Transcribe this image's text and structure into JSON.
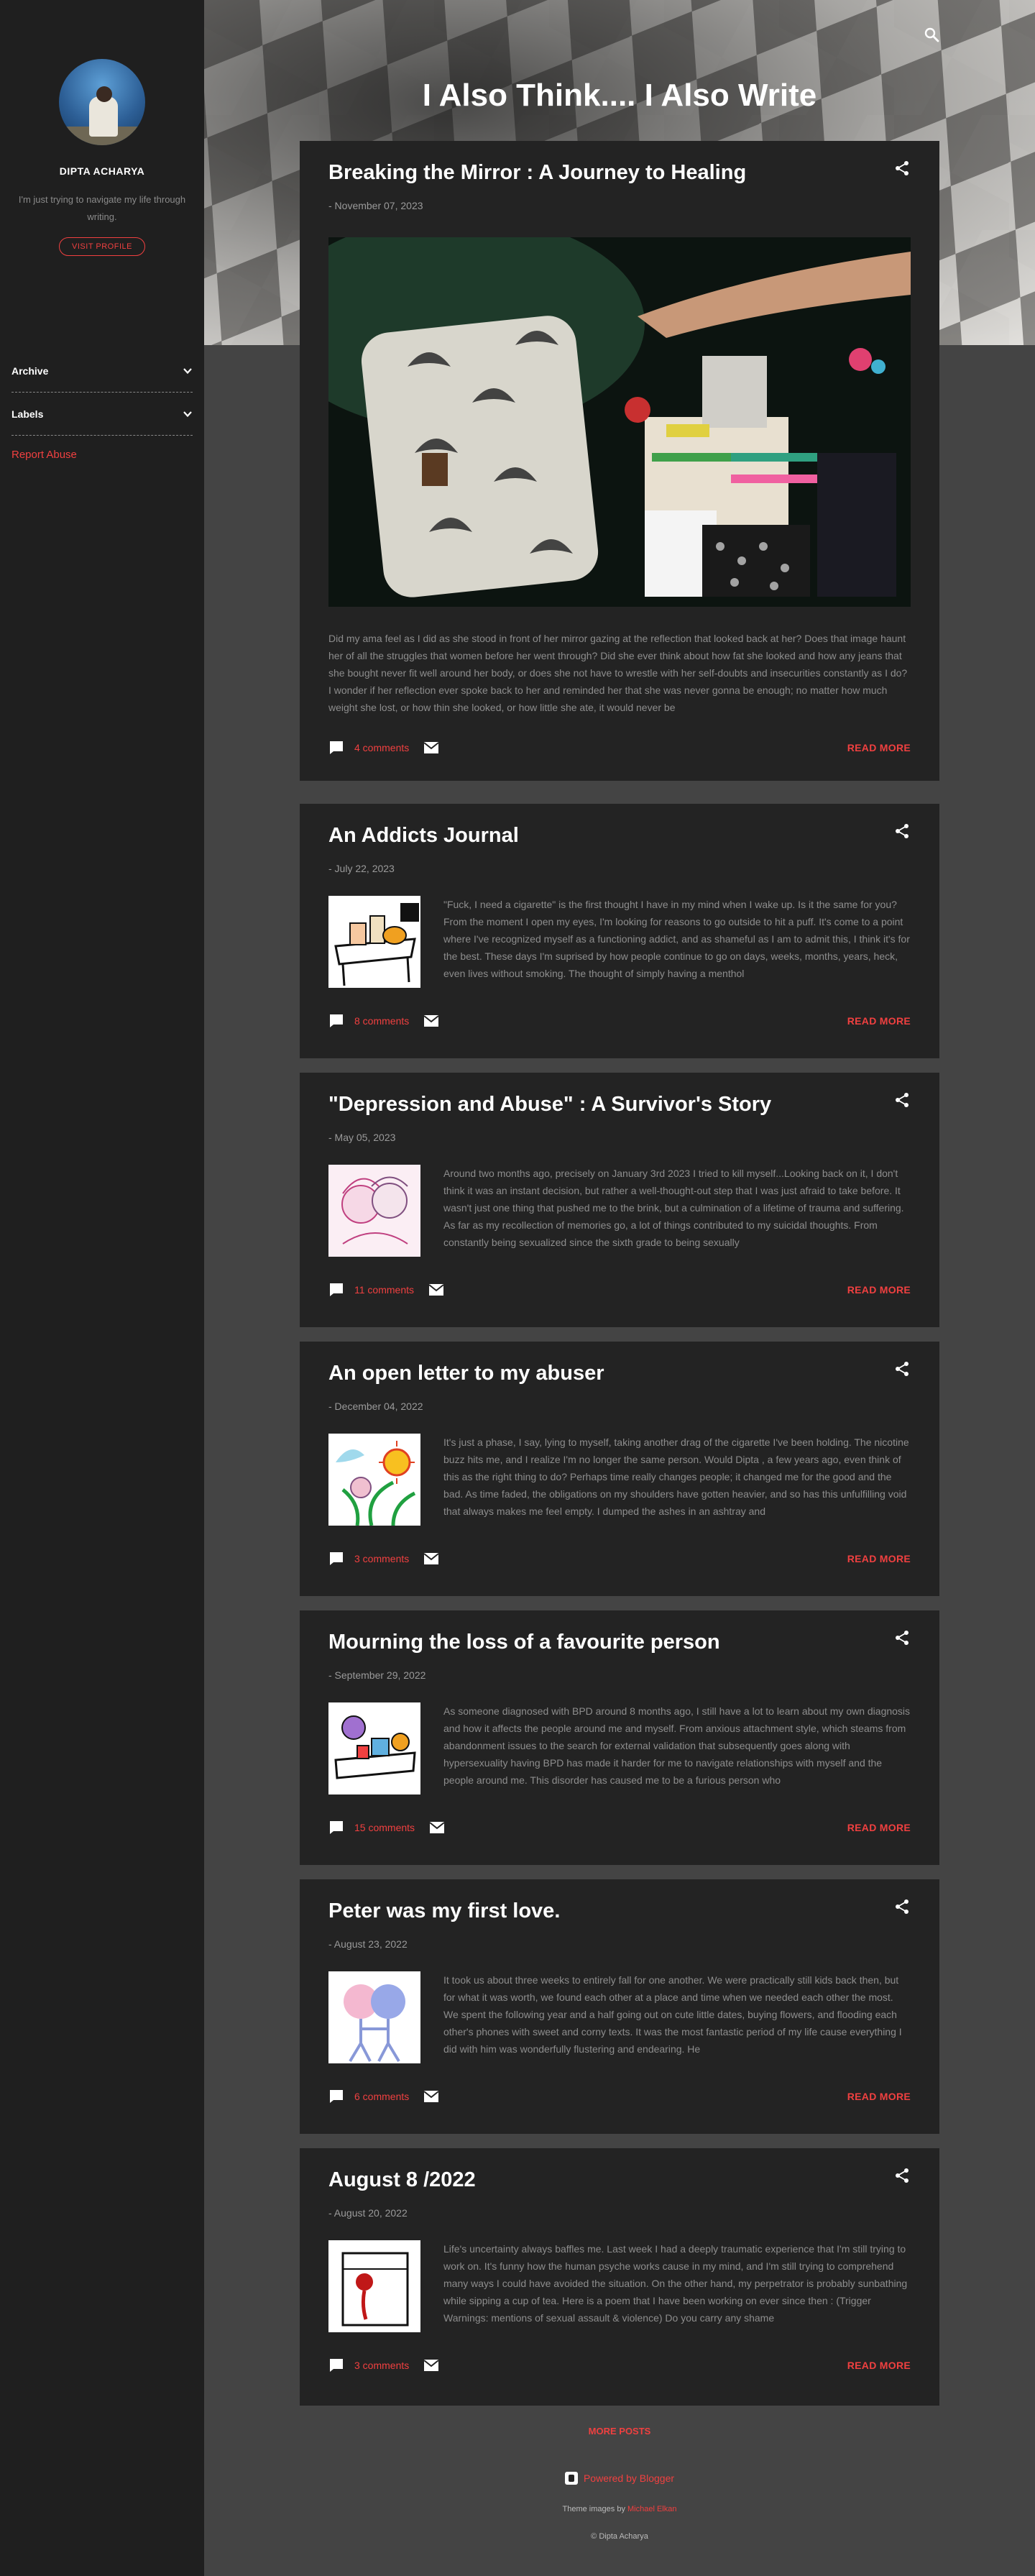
{
  "sidebar": {
    "profile_name": "DIPTA ACHARYA",
    "profile_desc": "I'm just trying to navigate my life through writing.",
    "visit_profile": "VISIT PROFILE",
    "sections": [
      {
        "label": "Archive"
      },
      {
        "label": "Labels"
      }
    ],
    "report_abuse": "Report Abuse"
  },
  "header": {
    "title": "I Also Think.... I Also Write"
  },
  "posts": [
    {
      "title": "Breaking the Mirror : A Journey to Healing",
      "date": "- November 07, 2023",
      "snippet": "Did my ama feel as I did as she stood in front of her mirror gazing at the reflection that looked back at her? Does that image haunt her of all the struggles that women before her went through? Did she ever think about how fat she looked and how any jeans that she bought never fit well around her body, or does she not have to wrestle with her self-doubts and insecurities constantly as I do? I wonder if her reflection ever spoke back to her and reminded her that she was never gonna be enough; no matter how much weight she lost, or how thin she looked, or how little she ate, it would never be",
      "comments": "4 comments",
      "read_more": "READ MORE"
    },
    {
      "title": "An Addicts Journal",
      "date": "- July 22, 2023",
      "snippet": "\"Fuck, I need a cigarette\" is the first thought I have in my mind when I wake up. Is it the same for you? From the moment I open my eyes, I'm looking for reasons to go outside to hit a puff. It's come to a point where I've recognized myself as a functioning addict, and as shameful as I am to admit this, I think it's for the best.  These days I'm suprised by how people continue to go on days, weeks, months, years, heck, even lives without smoking. The thought of simply having a menthol",
      "comments": "8 comments",
      "read_more": "READ MORE"
    },
    {
      "title": "\"Depression and Abuse\" : A Survivor's Story",
      "date": "- May 05, 2023",
      "snippet": "Around two months ago, precisely on January 3rd 2023 I tried to kill myself...Looking back on it, I don't think it was an instant decision, but rather a well-thought-out step that I was just afraid to take before. It wasn't just one thing that pushed me to the brink, but a culmination of a lifetime of trauma and suffering. As far as my recollection of memories go, a lot of things contributed to my suicidal thoughts. From constantly being sexualized since the sixth grade to being sexually",
      "comments": "11 comments",
      "read_more": "READ MORE"
    },
    {
      "title": "An open letter to my abuser",
      "date": "- December 04, 2022",
      "snippet": "It's just a phase, I say, lying to myself, taking another drag of the cigarette I've been holding. The nicotine buzz hits me, and I realize I'm no longer the same person. Would Dipta , a few years ago, even think of this as the right thing to do? Perhaps time really changes people; it changed me for the good and the bad. As time faded, the obligations on my shoulders have gotten heavier, and so has this unfulfilling void that always makes me feel empty. I dumped the ashes in an ashtray and",
      "comments": "3 comments",
      "read_more": "READ MORE"
    },
    {
      "title": "Mourning the loss of a favourite person",
      "date": "- September 29, 2022",
      "snippet": "As someone diagnosed with BPD around 8 months ago, I still have a lot to learn about my own diagnosis and how it affects the people around me and myself. From anxious attachment style, which steams from abandonment issues to the search for external validation that subsequently goes along with hypersexuality having BPD has made it harder for me to navigate relationships with myself and the people around me. This disorder has caused me to be a furious person who",
      "comments": "15 comments",
      "read_more": "READ MORE"
    },
    {
      "title": "Peter was my first love.",
      "date": "- August 23, 2022",
      "snippet": "It took us about three weeks to entirely fall for one another. We were practically still kids back then, but for what it was worth, we found each other at a place and time when we needed each other the most. We spent the following year and a half going out on cute little dates, buying flowers, and flooding each other's phones with sweet and corny texts. It was the most fantastic period of my life cause everything I did with him was wonderfully flustering and endearing. He",
      "comments": "6 comments",
      "read_more": "READ MORE"
    },
    {
      "title": "August 8 /2022",
      "date": "- August 20, 2022",
      "snippet": "Life's uncertainty always baffles me. Last week I had a deeply traumatic experience that I'm still trying to work on. It's funny how the human psyche works cause in my mind, and I'm still trying to comprehend many ways I could have avoided the situation. On the other hand, my perpetrator is probably sunbathing while sipping a cup of tea. Here is a poem that I have been working on ever since then :  (Trigger Warnings:  mentions of sexual assault & violence) Do you carry any shame",
      "comments": "3 comments",
      "read_more": "READ MORE"
    }
  ],
  "footer": {
    "more_posts": "MORE POSTS",
    "powered_by": "Powered by Blogger",
    "theme_prefix": "Theme images by ",
    "theme_author": "Michael Elkan",
    "copyright": "© Dipta Acharya"
  },
  "colors": {
    "accent": "#f04040",
    "page_bg": "#444444",
    "card_bg": "#232323",
    "sidebar_bg": "#1f1f1f"
  }
}
